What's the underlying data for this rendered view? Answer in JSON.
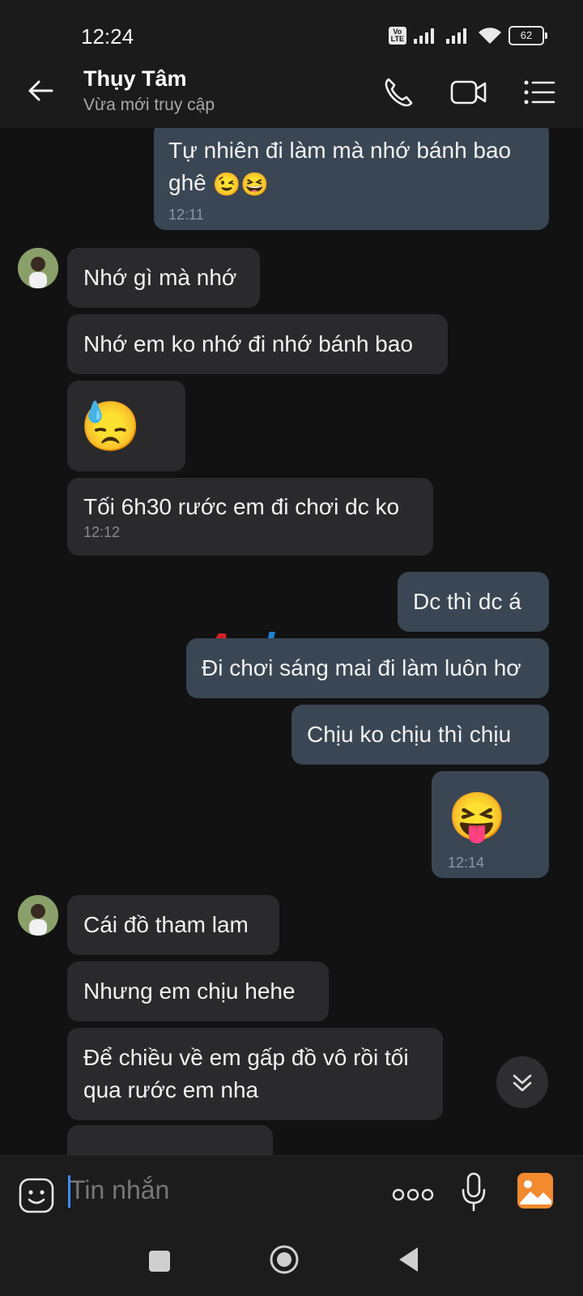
{
  "status_bar": {
    "time": "12:24",
    "volte": "Vo LTE",
    "battery": "62"
  },
  "header": {
    "contact_name": "Thụy Tâm",
    "contact_status": "Vừa mới truy cập"
  },
  "messages": [
    {
      "side": "out",
      "text": "Tự nhiên đi làm mà nhớ bánh bao ghê",
      "emoji": [
        "😉",
        "😆"
      ],
      "time": "12:11"
    },
    {
      "side": "in",
      "text": "Nhớ gì mà nhớ"
    },
    {
      "side": "in",
      "text": "Nhớ em ko nhớ đi nhớ bánh bao"
    },
    {
      "side": "in",
      "emoji": [
        "😓"
      ]
    },
    {
      "side": "in",
      "text": "Tối 6h30 rước em đi chơi dc ko",
      "time": "12:12"
    },
    {
      "side": "out",
      "text": "Dc thì dc á"
    },
    {
      "side": "out",
      "text": "Đi chơi sáng mai đi làm luôn hơ"
    },
    {
      "side": "out",
      "text": "Chịu ko chịu thì chịu"
    },
    {
      "side": "out",
      "emoji": [
        "😝"
      ],
      "time": "12:14"
    },
    {
      "side": "in",
      "text": "Cái đồ tham lam"
    },
    {
      "side": "in",
      "text": "Nhưng em chịu hehe"
    },
    {
      "side": "in",
      "text": "Để chiều về em gấp đồ vô rồi tối qua rước em nha"
    }
  ],
  "watermark": {
    "part1": "A",
    "part2": "phang"
  },
  "input": {
    "placeholder": "Tin nhắn"
  },
  "colors": {
    "outgoing_bubble": "#3a4654",
    "incoming_bubble": "#2a2a2c",
    "background": "#121212",
    "accent": "#3d8bfd"
  }
}
